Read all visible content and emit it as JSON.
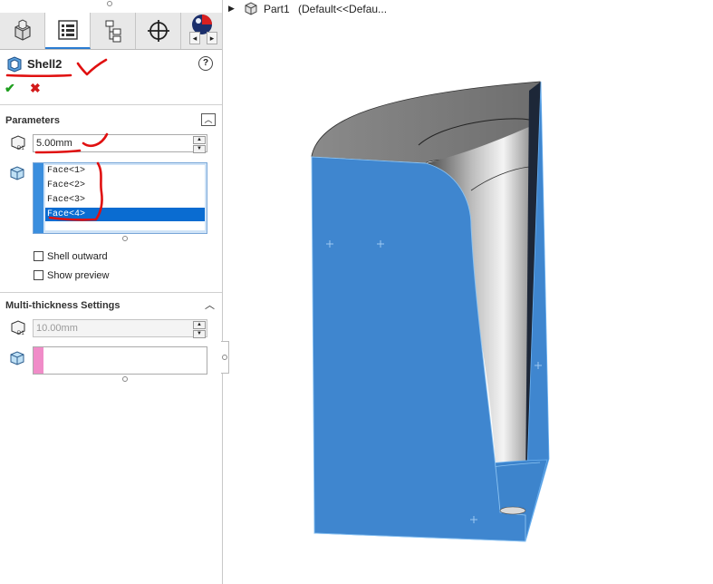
{
  "tabs": [
    {
      "name": "feature-manager",
      "icon": "part-icon"
    },
    {
      "name": "property-manager",
      "icon": "property-list-icon"
    },
    {
      "name": "configuration-manager",
      "icon": "config-tree-icon"
    },
    {
      "name": "dimxpert-manager",
      "icon": "crosshair-icon"
    },
    {
      "name": "display-manager",
      "icon": "appearance-ball-icon"
    }
  ],
  "feature": {
    "title": "Shell2",
    "icon": "shell-feature-icon",
    "ok_icon": "check-icon",
    "cancel_icon": "x-icon",
    "help": "?"
  },
  "parameters": {
    "header": "Parameters",
    "thickness": "5.00mm",
    "faces": [
      "Face<1>",
      "Face<2>",
      "Face<3>",
      "Face<4>"
    ],
    "selected_face_index": 3,
    "shell_outward": "Shell outward",
    "show_preview": "Show preview"
  },
  "multi": {
    "header": "Multi-thickness Settings",
    "thickness": "10.00mm"
  },
  "tree": {
    "part": "Part1",
    "config": "(Default<<Defau..."
  },
  "colors": {
    "accent": "#0a6cd1",
    "face_blue": "#3f86cf",
    "pink": "#f08cc8",
    "annotation": "#e01010"
  }
}
